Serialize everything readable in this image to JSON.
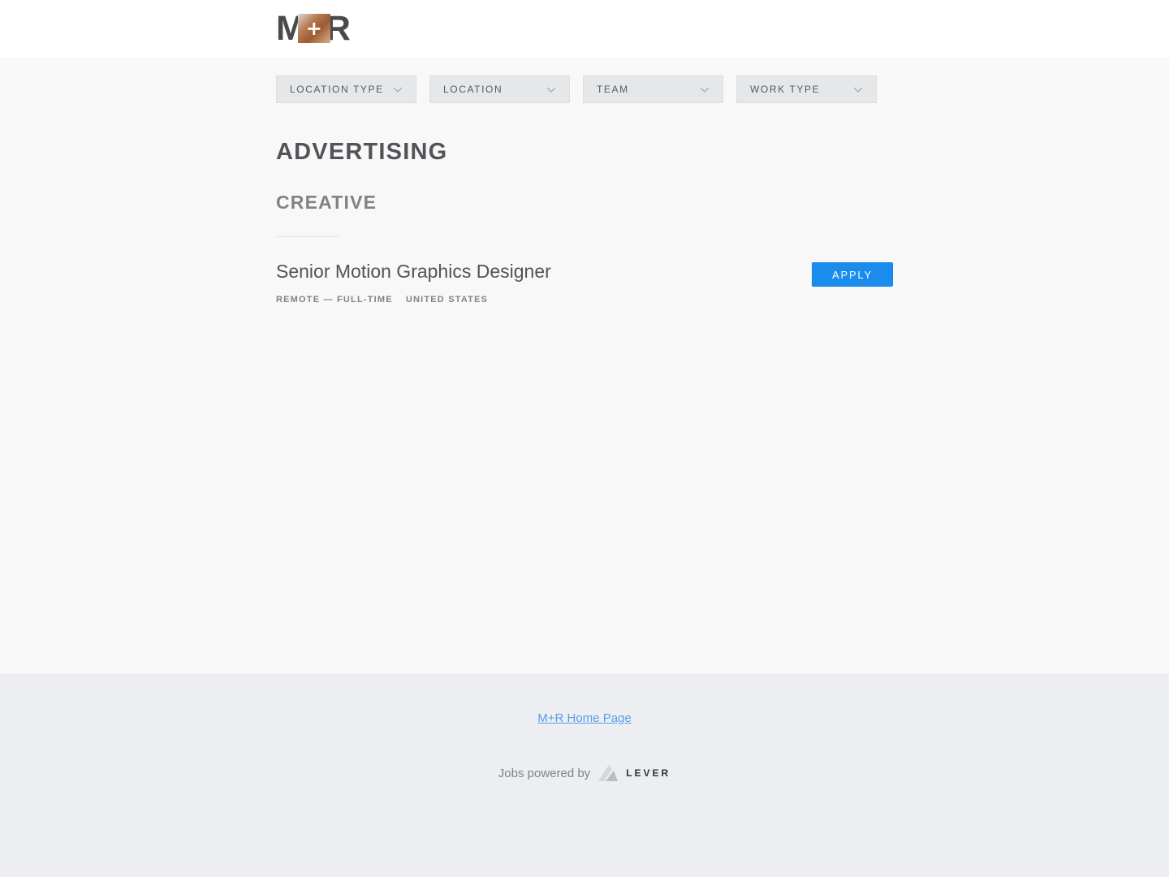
{
  "brand": {
    "logo_left": "M",
    "logo_plus": "+",
    "logo_right": "R"
  },
  "filters": [
    {
      "label": "LOCATION TYPE",
      "icon": "chevron-down-icon"
    },
    {
      "label": "LOCATION",
      "icon": "chevron-down-icon"
    },
    {
      "label": "TEAM",
      "icon": "chevron-down-icon"
    },
    {
      "label": "WORK TYPE",
      "icon": "chevron-down-icon"
    }
  ],
  "department": {
    "title": "ADVERTISING",
    "team": "CREATIVE"
  },
  "postings": [
    {
      "title": "Senior Motion Graphics Designer",
      "commitment": "REMOTE — FULL-TIME",
      "location": "UNITED STATES",
      "apply_label": "APPLY"
    }
  ],
  "footer": {
    "home_link": "M+R Home Page",
    "powered_by": "Jobs powered by",
    "lever_word": "LEVER"
  },
  "colors": {
    "accent": "#1a8cee",
    "link": "#579eee",
    "page_bg": "#f8f8f9",
    "footer_bg": "#edeef1"
  }
}
